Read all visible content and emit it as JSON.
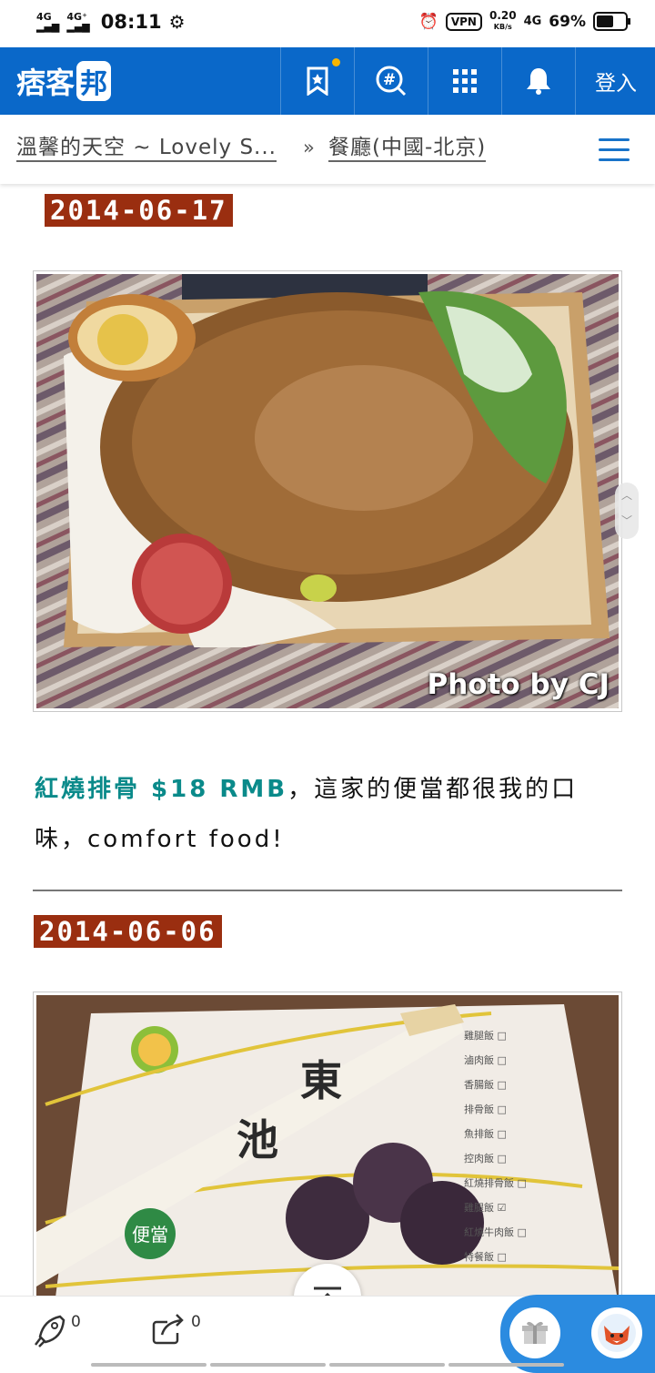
{
  "status_bar": {
    "signal_left": "4G",
    "signal_right": "4G⁺",
    "time": "08:11",
    "vpn": "VPN",
    "speed_value": "0.20",
    "speed_unit": "KB/s",
    "network": "4G",
    "battery": "69%",
    "battery_level": 0.69
  },
  "nav": {
    "logo_left": "痞客",
    "logo_box": "邦",
    "login_label": "登入",
    "brand_color": "#0a68c9",
    "icons": [
      "bookmark-star-icon",
      "hashtag-search-icon",
      "grid-icon",
      "bell-icon"
    ]
  },
  "breadcrumb": {
    "blog": "溫馨的天空 ~ Lovely S...",
    "separator": "»",
    "category": "餐廳(中國-北京)"
  },
  "posts": [
    {
      "date": "2014-06-17",
      "photo_watermark": "Photo by CJ",
      "highlight": "紅燒排骨 $18 RMB",
      "text": "，這家的便當都很我的口味，comfort food!"
    },
    {
      "date": "2014-06-06"
    }
  ],
  "bottom_bar": {
    "like_count": "0",
    "share_count": "0"
  }
}
